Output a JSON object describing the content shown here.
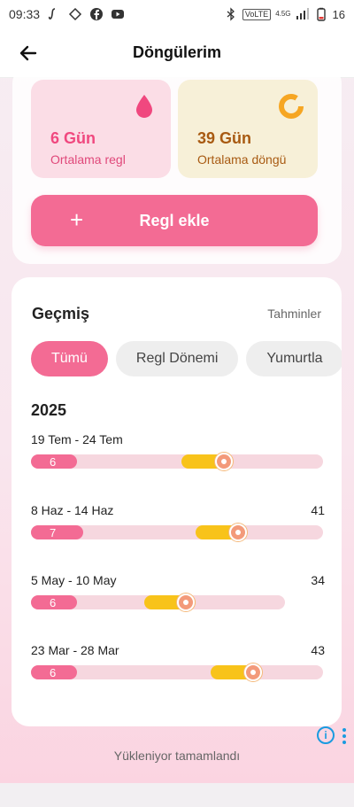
{
  "status_bar": {
    "time": "09:33",
    "battery": "16",
    "network_badge": "VoLTE",
    "network_gen": "4.5G"
  },
  "header": {
    "title": "Döngülerim"
  },
  "stats": {
    "period": {
      "value": "6 Gün",
      "label": "Ortalama regl",
      "icon": "drop-icon",
      "color": "#f0487f"
    },
    "cycle": {
      "value": "39 Gün",
      "label": "Ortalama döngü",
      "icon": "ring-icon",
      "color": "#f6a623"
    }
  },
  "add_button": {
    "label": "Regl ekle",
    "icon": "plus-icon"
  },
  "history": {
    "title": "Geçmiş",
    "predictions_link": "Tahminler",
    "filters": [
      {
        "label": "Tümü",
        "active": true
      },
      {
        "label": "Regl Dönemi",
        "active": false
      },
      {
        "label": "Yumurtla",
        "active": false
      }
    ],
    "year": "2025",
    "cycles": [
      {
        "range": "19 Tem - 24 Tem",
        "length": "",
        "period_days": "6"
      },
      {
        "range": "8 Haz - 14 Haz",
        "length": "41",
        "period_days": "7"
      },
      {
        "range": "5 May - 10 May",
        "length": "34",
        "period_days": "6"
      },
      {
        "range": "23 Mar - 28 Mar",
        "length": "43",
        "period_days": "6"
      }
    ]
  },
  "footer": {
    "status": "Yükleniyor tamamlandı"
  },
  "colors": {
    "accent": "#f36b94",
    "fertile": "#f8c31a",
    "track": "#f6d7df"
  }
}
